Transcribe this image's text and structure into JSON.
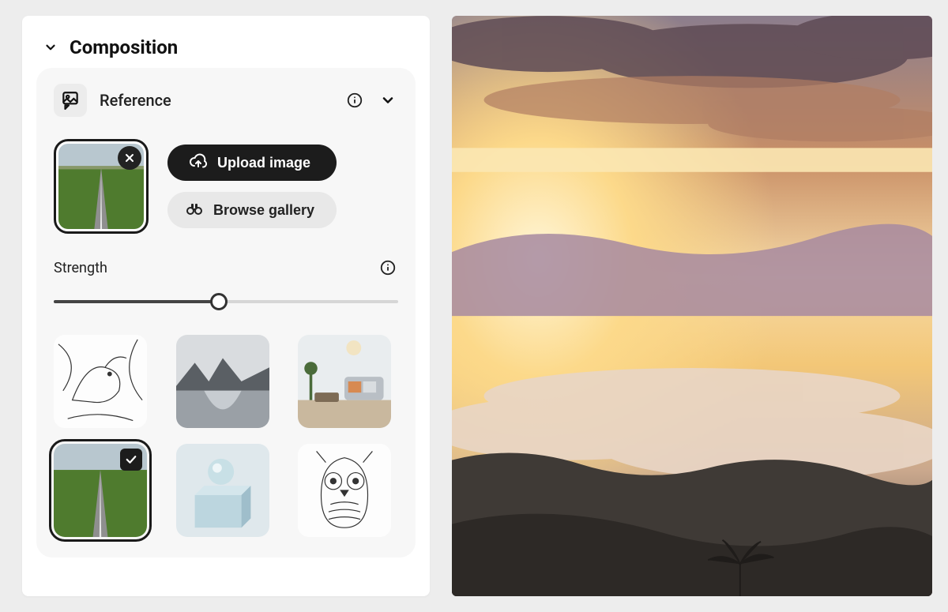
{
  "section": {
    "title": "Composition"
  },
  "reference": {
    "title": "Reference",
    "upload_label": "Upload image",
    "browse_label": "Browse gallery",
    "selected_thumb": "road-field"
  },
  "strength": {
    "label": "Strength",
    "value": 48
  },
  "gallery": {
    "items": [
      {
        "id": "bird-lineart",
        "selected": false
      },
      {
        "id": "mountain-lake",
        "selected": false
      },
      {
        "id": "living-room",
        "selected": false
      },
      {
        "id": "road-field",
        "selected": true
      },
      {
        "id": "sphere-cube",
        "selected": false
      },
      {
        "id": "owl-lineart",
        "selected": false
      }
    ]
  },
  "preview": {
    "description": "sunset-clouds-over-mountains"
  }
}
